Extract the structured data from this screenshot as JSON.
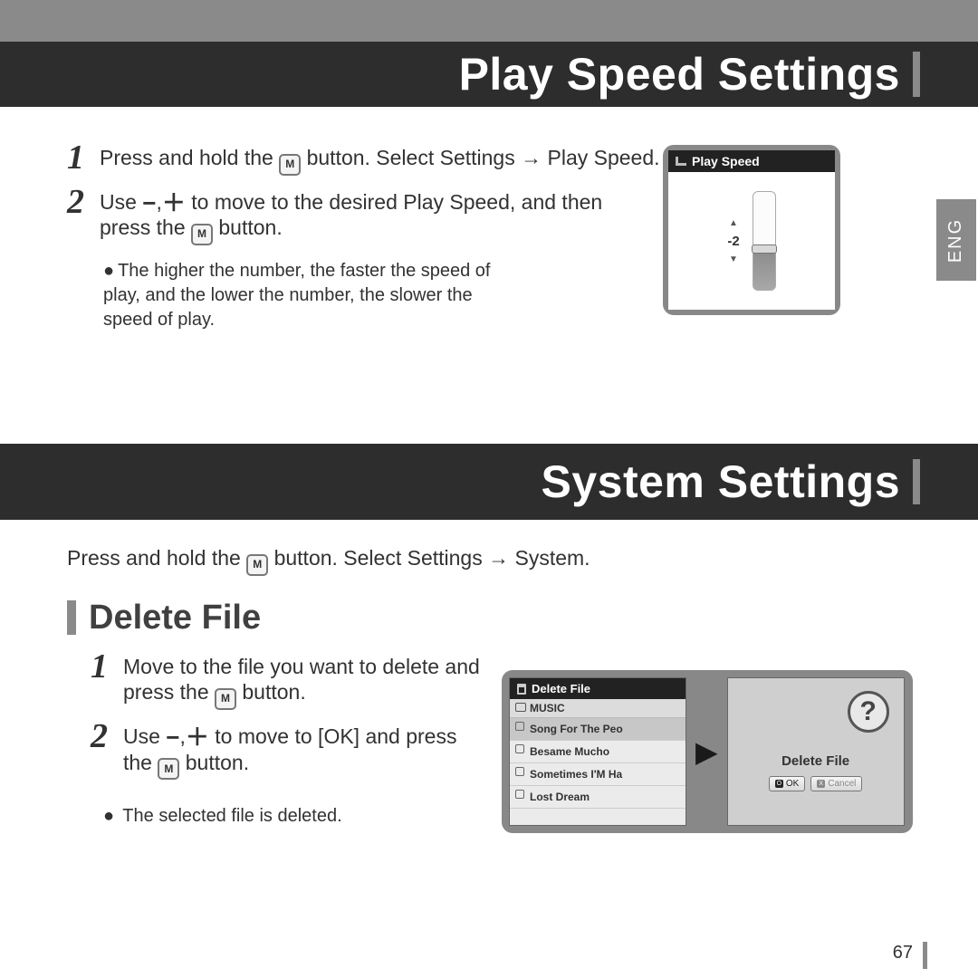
{
  "lang_tab": "ENG",
  "page_number": "67",
  "section1": {
    "title": "Play Speed Settings",
    "steps": [
      {
        "num": "1",
        "pre": "Press and hold the ",
        "post": " button. Select Settings → Play Speed."
      },
      {
        "num": "2",
        "part1": "Use ",
        "part2": " to move to the desired Play Speed, and then press the ",
        "part3": " button."
      }
    ],
    "note": "The higher the number, the faster the speed of play, and the lower the number, the slower the speed of play.",
    "device": {
      "title": "Play Speed",
      "value": "-2"
    }
  },
  "section2": {
    "title": "System Settings",
    "intro_pre": "Press and hold the ",
    "intro_post": " button. Select Settings → System.",
    "sub_heading": "Delete File",
    "steps": [
      {
        "num": "1",
        "pre": "Move to the file you want to delete and press the ",
        "post": " button."
      },
      {
        "num": "2",
        "part1": "Use ",
        "part2": "  to move to [OK] and press the ",
        "part3": " button."
      }
    ],
    "note": "The selected file is deleted.",
    "device": {
      "title": "Delete File",
      "category": "MUSIC",
      "rows": [
        {
          "label": "Song For The Peo",
          "selected": true
        },
        {
          "label": "Besame Mucho",
          "selected": false
        },
        {
          "label": "Sometimes I'M Ha",
          "selected": false
        },
        {
          "label": "Lost Dream",
          "selected": false
        }
      ],
      "dialog_caption": "Delete File",
      "ok_label": "OK",
      "cancel_label": "Cancel"
    }
  }
}
